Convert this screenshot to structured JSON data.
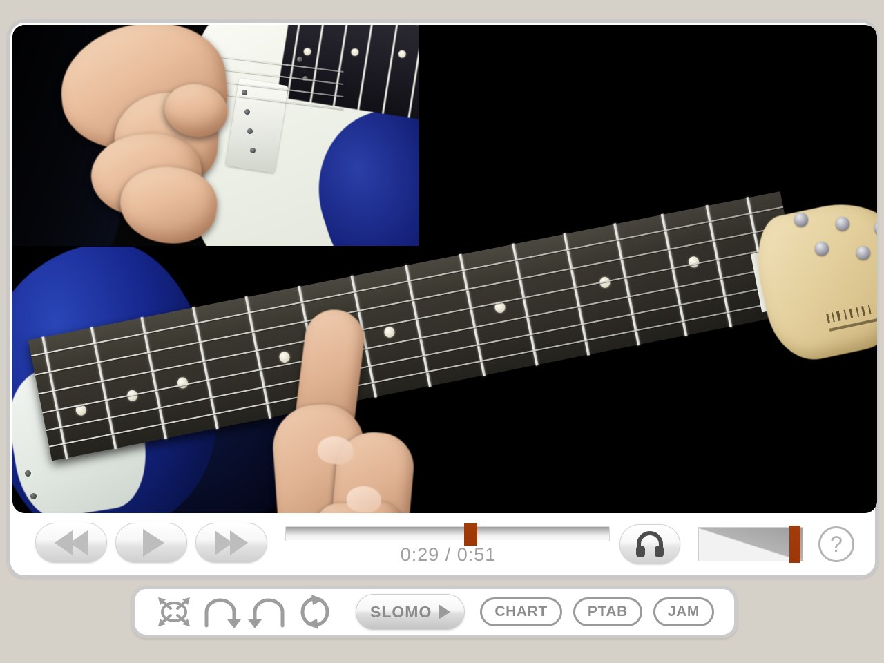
{
  "app": {
    "title": "Guitar Lesson Video Player",
    "page_background": "#d5d1c8",
    "panel_background": "#ffffff",
    "panel_border": "#c9c9c9",
    "accent_color": "#a33c0a",
    "control_gray": "#b0b0b0"
  },
  "video": {
    "name": "guitar-lesson-video",
    "main_view_label": "fretboard-camera",
    "pip_view_label": "picking-hand-camera",
    "background": "#000000"
  },
  "transport": {
    "rewind_label": "Rewind",
    "play_label": "Play",
    "fastforward_label": "Fast Forward",
    "rewind_icon": "rewind-icon",
    "play_icon": "play-icon",
    "fastforward_icon": "fast-forward-icon",
    "audio_icon": "headphones-icon",
    "audio_label": "Audio",
    "help_label": "?",
    "help_icon": "help-icon"
  },
  "scrubber": {
    "current_time": "0:29",
    "total_time": "0:51",
    "time_display": "0:29 / 0:51",
    "progress_percent": 57,
    "handle_color": "#a33c0a"
  },
  "volume": {
    "label": "Volume",
    "level_percent": 92,
    "handle_color": "#a33c0a"
  },
  "toolbar": {
    "icons": [
      {
        "name": "fullscreen-icon",
        "label": "Full Screen"
      },
      {
        "name": "loop-start-icon",
        "label": "Set Loop Start"
      },
      {
        "name": "loop-end-icon",
        "label": "Set Loop End"
      },
      {
        "name": "loop-repeat-icon",
        "label": "Loop Repeat"
      }
    ],
    "slomo_label": "SLOMO",
    "slomo_icon": "play-triangle-icon",
    "buttons": [
      {
        "label": "CHART",
        "name": "chart-button"
      },
      {
        "label": "PTAB",
        "name": "ptab-button"
      },
      {
        "label": "JAM",
        "name": "jam-button"
      }
    ]
  }
}
